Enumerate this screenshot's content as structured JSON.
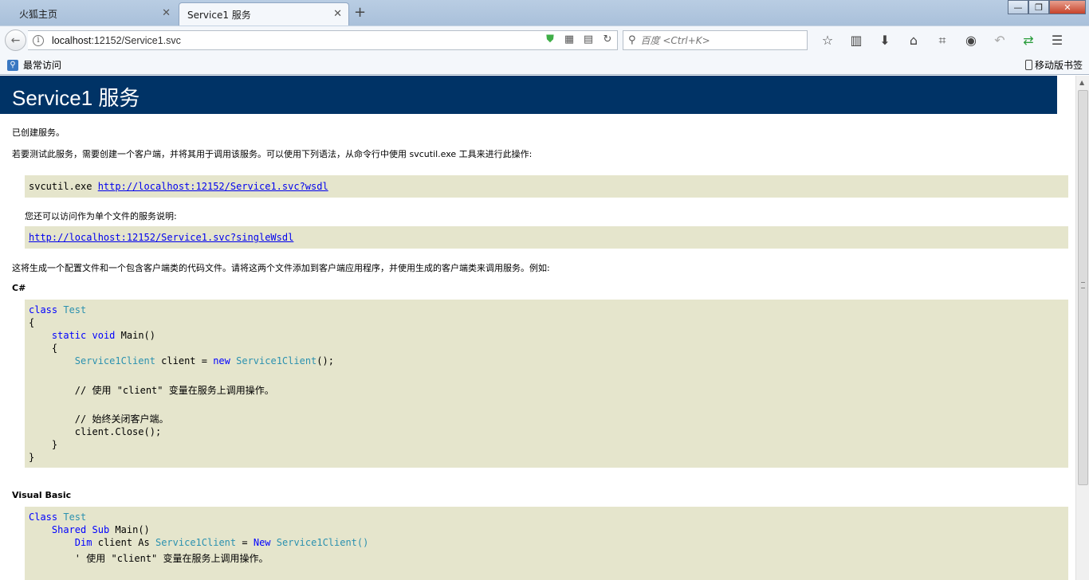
{
  "tabs": [
    {
      "label": "火狐主页",
      "close": "✕"
    },
    {
      "label": "Service1 服务",
      "close": "✕"
    }
  ],
  "new_tab": "+",
  "window_controls": {
    "minimize": "—",
    "maximize": "❐",
    "close": "✕"
  },
  "nav": {
    "back": "←",
    "url_prefix": "localhost",
    "url_rest": ":12152/Service1.svc",
    "search_placeholder": "百度 <Ctrl+K>",
    "toolbar_icons": [
      "star-icon",
      "reading-list-icon",
      "download-icon",
      "home-icon",
      "screenshot-icon",
      "chat-icon",
      "undo-icon",
      "sync-icon",
      "menu-icon"
    ]
  },
  "bookmarks": {
    "left_label": "最常访问",
    "right_label": "移动版书签"
  },
  "page": {
    "title": "Service1 服务",
    "created": "已创建服务。",
    "intro": "若要测试此服务，需要创建一个客户端，并将其用于调用该服务。可以使用下列语法，从命令行中使用 svcutil.exe 工具来进行此操作:",
    "svcutil_cmd": "svcutil.exe ",
    "wsdl_link": "http://localhost:12152/Service1.svc?wsdl",
    "single_file_note": "您还可以访问作为单个文件的服务说明:",
    "single_wsdl_link": "http://localhost:12152/Service1.svc?singleWsdl",
    "generate_note": "这将生成一个配置文件和一个包含客户端类的代码文件。请将这两个文件添加到客户端应用程序，并使用生成的客户端类来调用服务。例如:",
    "csharp_label": "C#",
    "vb_label": "Visual Basic"
  },
  "csharp": {
    "kw_class": "class",
    "test": "Test",
    "open1": "{",
    "kw_static": "static",
    "kw_void": "void",
    "main": "Main()",
    "open2": "{",
    "client_type": "Service1Client",
    "client_decl": " client = ",
    "kw_new": "new",
    "client_ctor": "Service1Client",
    "ctor_end": "();",
    "comment1": "// 使用 \"client\" 变量在服务上调用操作。",
    "comment2": "// 始终关闭客户端。",
    "close_call": "client.Close();",
    "close2": "}",
    "close1": "}"
  },
  "vb": {
    "kw_class": "Class",
    "test": "Test",
    "kw_shared": "Shared",
    "kw_sub": "Sub",
    "main": "Main()",
    "kw_dim": "Dim",
    "client_as": "client As",
    "client_type": "Service1Client",
    "eq": "=",
    "kw_new": "New",
    "client_ctor": "Service1Client()",
    "comment1": "' 使用 \"client\" 变量在服务上调用操作。"
  },
  "colors": {
    "header_bg": "#003366",
    "code_bg": "#e5e5cc",
    "keyword": "#0000ff",
    "type": "#2b91af",
    "comment": "#008000",
    "link": "#0000ee"
  }
}
